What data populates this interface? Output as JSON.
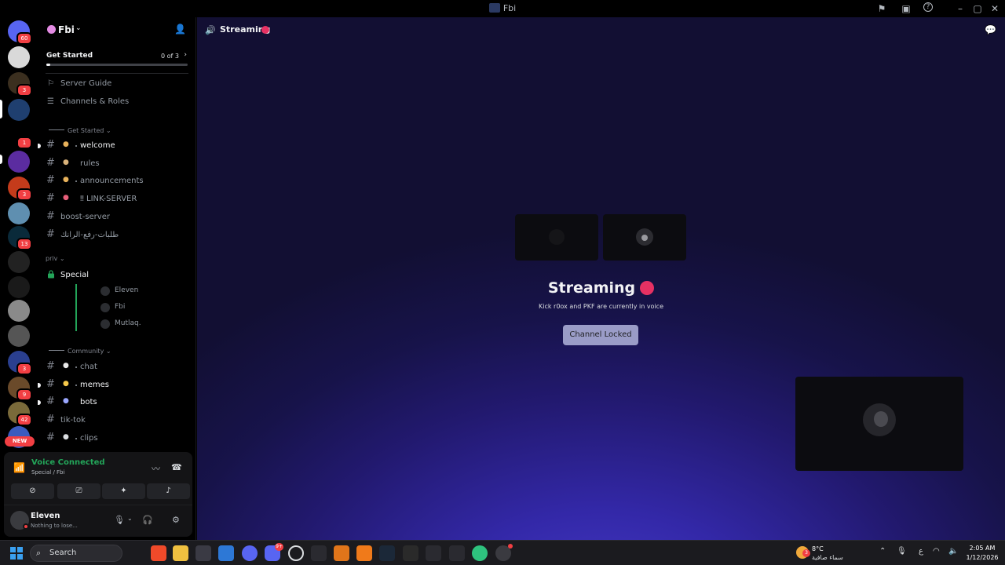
{
  "window": {
    "title": "Fbi"
  },
  "rail": {
    "servers": [
      {
        "name": "discord-home",
        "color": "#5865f2",
        "badge": "60"
      },
      {
        "name": "server-avatar",
        "color": "#d9d9d9",
        "badge": ""
      },
      {
        "name": "server-monster",
        "color": "#3b2f1f",
        "badge": "3"
      },
      {
        "name": "server-blue",
        "color": "#1f3f6f",
        "badge": ""
      },
      {
        "name": "server-rx",
        "color": "#000000",
        "badge": "1"
      },
      {
        "name": "server-nox",
        "color": "#5b2ca0",
        "badge": ""
      },
      {
        "name": "server-mt",
        "color": "#c43b1b",
        "badge": "3"
      },
      {
        "name": "server-wolf",
        "color": "#5f8fb0",
        "badge": ""
      },
      {
        "name": "server-a",
        "color": "#0a2a3a",
        "badge": "13"
      },
      {
        "name": "server-circle",
        "color": "#222222",
        "badge": ""
      },
      {
        "name": "server-dark",
        "color": "#1a1a1a",
        "badge": ""
      },
      {
        "name": "server-skull",
        "color": "#8a8a8a",
        "badge": ""
      },
      {
        "name": "server-bw",
        "color": "#555555",
        "badge": ""
      },
      {
        "name": "server-flag",
        "color": "#2a3f8f",
        "badge": "3"
      },
      {
        "name": "server-arabic",
        "color": "#6a4a2a",
        "badge": "9"
      },
      {
        "name": "server-gold",
        "color": "#7a6a3a",
        "badge": "42"
      },
      {
        "name": "server-bb",
        "color": "#3b5bbf",
        "badge": ""
      }
    ],
    "new_label": "NEW"
  },
  "guild": {
    "name": "Fbi",
    "get_started": {
      "label": "Get Started",
      "count": "0 of 3",
      "progress": 0.03
    },
    "nav": [
      {
        "label": "Server Guide",
        "icon": "signpost-icon"
      },
      {
        "label": "Channels & Roles",
        "icon": "list-icon"
      }
    ],
    "categories": {
      "get_started": "Get Started",
      "priv": "priv",
      "community": "Community"
    },
    "channels_top": [
      {
        "label": "welcome",
        "emoji": "👋",
        "emo_color": "#e8b25b",
        "unread": true,
        "dot": true
      },
      {
        "label": "rules",
        "emoji": "📜",
        "emo_color": "#d9b27a",
        "unread": false,
        "dot": false
      },
      {
        "label": "announcements",
        "emoji": "🔔",
        "emo_color": "#e8b25b",
        "unread": false,
        "dot": true
      },
      {
        "label": "‼ LINK-SERVER",
        "emoji": "📩",
        "emo_color": "#e85f7a",
        "unread": false,
        "dot": false
      },
      {
        "label": "boost-server",
        "emoji": "",
        "emo_color": "",
        "unread": false,
        "dot": false
      },
      {
        "label": "طلبات-رفع-الرانك",
        "emoji": "",
        "emo_color": "",
        "unread": false,
        "dot": false
      }
    ],
    "voice_channel": {
      "label": "Special"
    },
    "voice_users": [
      "Eleven",
      "Fbi",
      "Mutlaq."
    ],
    "channels_bottom": [
      {
        "label": "chat",
        "emoji": "💬",
        "emo_color": "#e8e8e8",
        "unread": false,
        "dot": true
      },
      {
        "label": "memes",
        "emoji": "😂",
        "emo_color": "#f5c84a",
        "unread": true,
        "dot": true
      },
      {
        "label": "bots",
        "emoji": "🤖",
        "emo_color": "#9aa7ff",
        "unread": true,
        "dot": false
      },
      {
        "label": "tik-tok",
        "emoji": "",
        "emo_color": "",
        "unread": false,
        "dot": false
      },
      {
        "label": "clips",
        "emoji": "📁",
        "emo_color": "#dbdee1",
        "unread": false,
        "dot": true
      }
    ]
  },
  "voice_panel": {
    "title": "Voice Connected",
    "subtitle": "Special / Fbi",
    "buttons": [
      "camera-off",
      "screen-share",
      "activities",
      "soundboard"
    ]
  },
  "user": {
    "name": "Eleven",
    "status": "Nothing to lose..."
  },
  "main": {
    "channel_name": "Streaming",
    "stage_title": "Streaming",
    "stage_subtitle": "Kick r0ox and PKF are currently in voice",
    "locked_button": "Channel Locked"
  },
  "taskbar": {
    "search_label": "Search",
    "apps_badge": "9+",
    "weather_temp": "8°C",
    "weather_desc": "سماء صافية",
    "weather_badge": "3",
    "lang": "ع",
    "time": "2:05 AM",
    "date": "1/12/2026"
  }
}
